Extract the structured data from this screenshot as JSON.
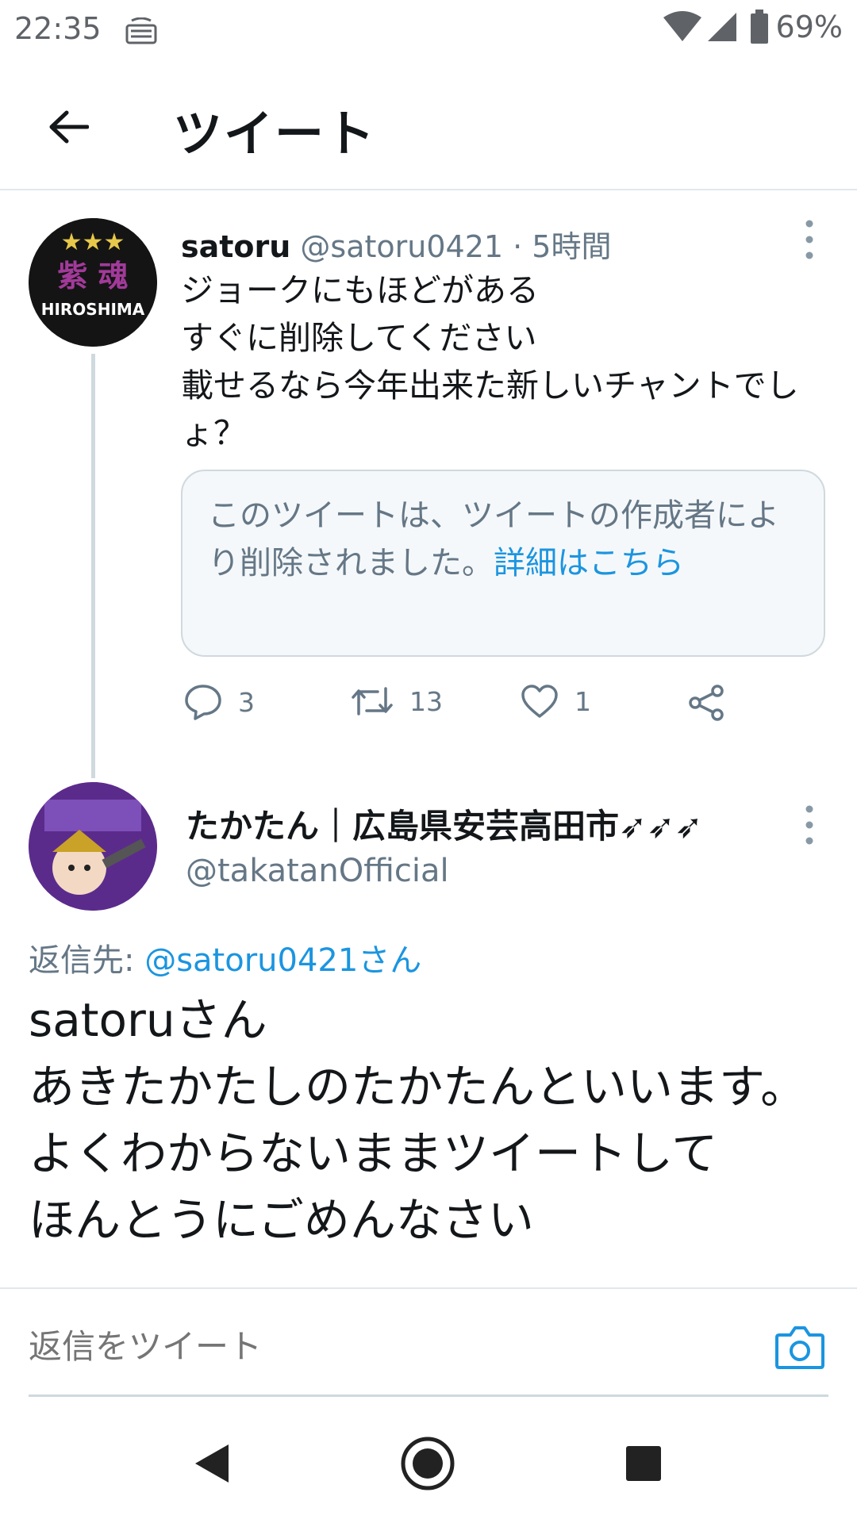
{
  "status_bar": {
    "time": "22:35",
    "battery": "69%"
  },
  "header": {
    "title": "ツイート"
  },
  "tweet1": {
    "name": "satoru",
    "meta": "@satoru0421 · 5時間",
    "body": "ジョークにもほどがある\nすぐに削除してください\n載せるなら今年出来た新しいチャントでしょ？",
    "quote_text": "このツイートは、ツイートの作成者により削除されました。",
    "quote_link": "詳細はこちら",
    "avatar_text_top": "紫 魂",
    "avatar_text_bottom": "HIROSHIMA",
    "replies": "3",
    "retweets": "13",
    "likes": "1"
  },
  "tweet2": {
    "name": "たかたん｜広島県安芸高田市➶➶➶",
    "handle": "@takatanOfficial",
    "reply_prefix": "返信先: ",
    "reply_to": "@satoru0421さん",
    "body": "satoruさん\nあきたかたしのたかたんといいます。\nよくわからないままツイートして\nほんとうにごめんなさい"
  },
  "composer": {
    "placeholder": "返信をツイート"
  },
  "colors": {
    "accent": "#1b95e0",
    "secondary_text": "#657786",
    "divider": "#e1e8ed"
  }
}
